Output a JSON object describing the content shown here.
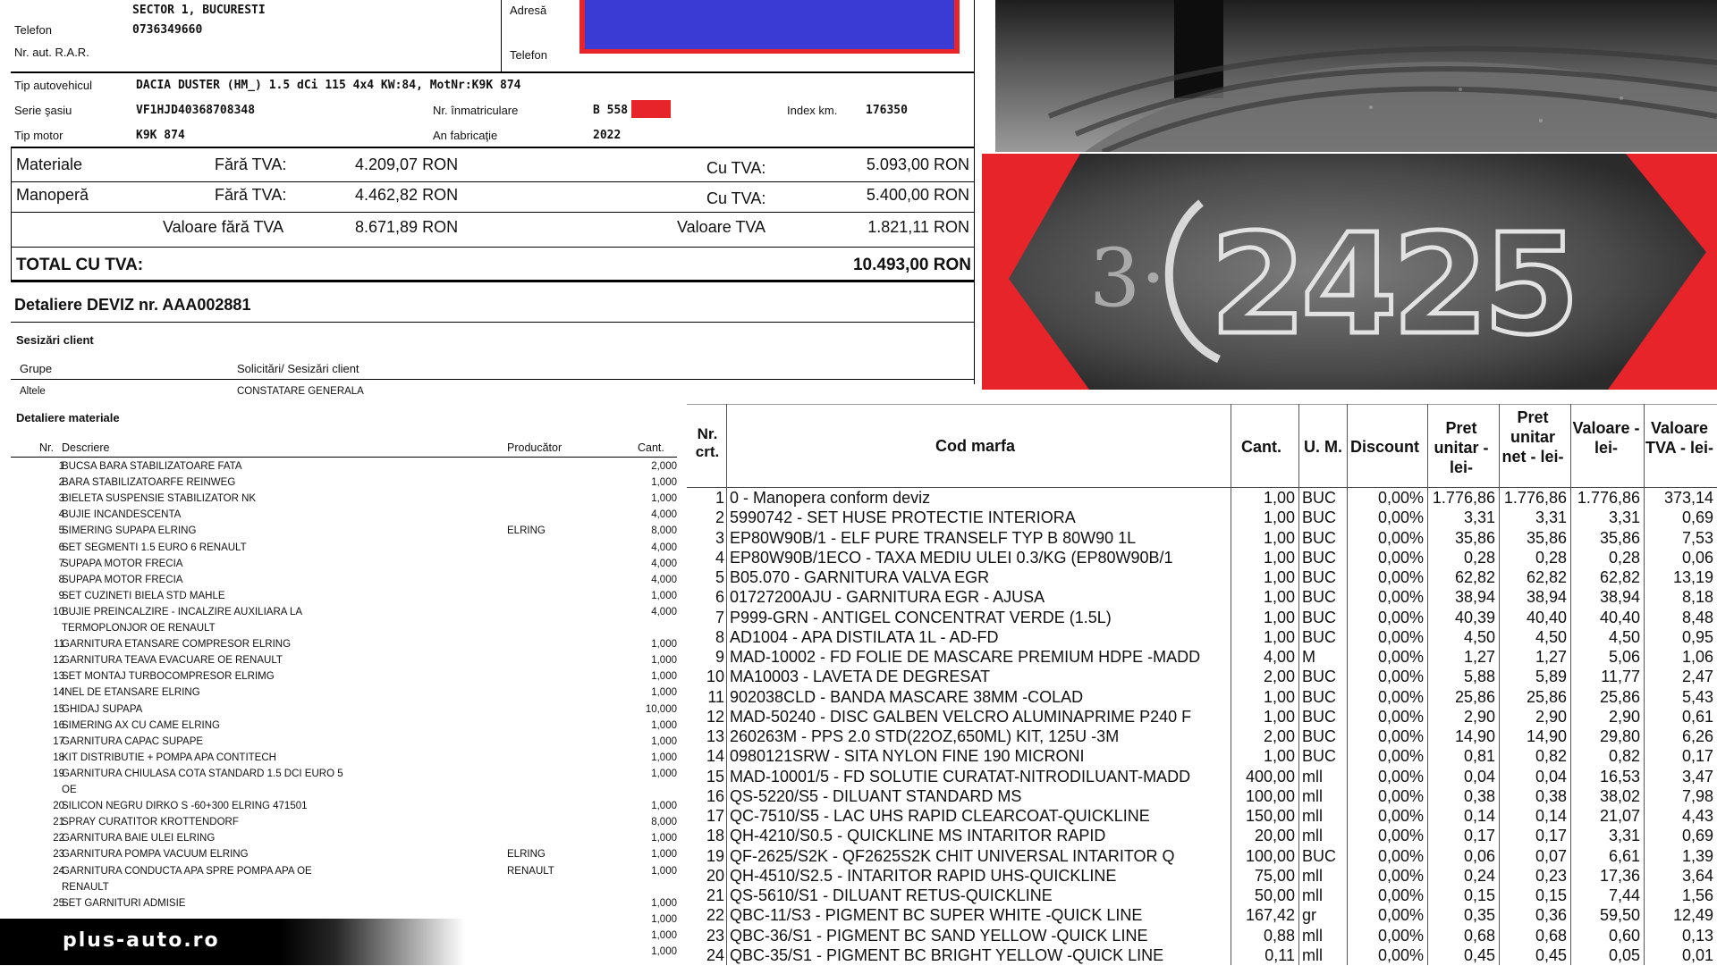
{
  "header": {
    "address_line": "SECTOR 1, BUCURESTI",
    "phone_label": "Telefon",
    "phone_value": "0736349660",
    "rar_label": "Nr. aut. R.A.R.",
    "client_address_label": "Adresă",
    "client_phone_label": "Telefon"
  },
  "vehicle": {
    "type_label": "Tip autovehicul",
    "type_value": "DACIA DUSTER (HM_) 1.5 dCi 115 4x4 KW:84, MotNr:K9K 874",
    "vin_label": "Serie şasiu",
    "vin_value": "VF1HJD40368708348",
    "plate_label": "Nr. înmatriculare",
    "plate_value": "B 558",
    "km_label": "Index km.",
    "km_value": "176350",
    "engine_label": "Tip motor",
    "engine_value": "K9K 874",
    "year_label": "An fabricaţie",
    "year_value": "2022"
  },
  "summary": {
    "materials_label": "Materiale",
    "labour_label": "Manoperă",
    "no_vat_label": "Fără TVA:",
    "with_vat_label": "Cu TVA:",
    "materials_no_vat": "4.209,07 RON",
    "materials_with_vat": "5.093,00 RON",
    "labour_no_vat": "4.462,82 RON",
    "labour_with_vat": "5.400,00 RON",
    "value_no_vat_label": "Valoare fără TVA",
    "value_no_vat": "8.671,89 RON",
    "vat_value_label": "Valoare TVA",
    "vat_value": "1.821,11 RON",
    "total_label": "TOTAL CU TVA:",
    "total_value": "10.493,00 RON"
  },
  "deviz_title": "Detaliere DEVIZ nr. AAA002881",
  "complaints": {
    "title": "Sesizări client",
    "col_group": "Grupe",
    "col_request": "Solicitări/ Sesizări client",
    "row_group": "Altele",
    "row_request": "CONSTATARE GENERALA"
  },
  "materials": {
    "title": "Detaliere materiale",
    "col_nr": "Nr.",
    "col_desc": "Descriere",
    "col_producer": "Producător",
    "col_qty": "Cant.",
    "rows": [
      {
        "nr": "1",
        "desc": "BUCSA BARA STABILIZATOARE FATA",
        "prod": "",
        "qty": "2,000"
      },
      {
        "nr": "2",
        "desc": "BARA STABILIZATOARFE REINWEG",
        "prod": "",
        "qty": "1,000"
      },
      {
        "nr": "3",
        "desc": "BIELETA SUSPENSIE STABILIZATOR NK",
        "prod": "",
        "qty": "1,000"
      },
      {
        "nr": "4",
        "desc": "BUJIE INCANDESCENTA",
        "prod": "",
        "qty": "4,000"
      },
      {
        "nr": "5",
        "desc": "SIMERING SUPAPA ELRING",
        "prod": "ELRING",
        "qty": "8,000"
      },
      {
        "nr": "6",
        "desc": "SET SEGMENTI 1.5 EURO 6 RENAULT",
        "prod": "",
        "qty": "4,000"
      },
      {
        "nr": "7",
        "desc": "SUPAPA MOTOR FRECIA",
        "prod": "",
        "qty": "4,000"
      },
      {
        "nr": "8",
        "desc": "SUPAPA MOTOR FRECIA",
        "prod": "",
        "qty": "4,000"
      },
      {
        "nr": "9",
        "desc": "SET CUZINETI BIELA STD MAHLE",
        "prod": "",
        "qty": "1,000"
      },
      {
        "nr": "10",
        "desc": "BUJIE PREINCALZIRE - INCALZIRE AUXILIARA LA",
        "prod": "",
        "qty": "4,000"
      },
      {
        "nr": "",
        "desc": "TERMOPLONJOR OE RENAULT",
        "prod": "",
        "qty": ""
      },
      {
        "nr": "11",
        "desc": "GARNITURA ETANSARE COMPRESOR ELRING",
        "prod": "",
        "qty": "1,000"
      },
      {
        "nr": "12",
        "desc": "GARNITURA TEAVA EVACUARE OE RENAULT",
        "prod": "",
        "qty": "1,000"
      },
      {
        "nr": "13",
        "desc": "SET MONTAJ TURBOCOMPRESOR ELRIMG",
        "prod": "",
        "qty": "1,000"
      },
      {
        "nr": "14",
        "desc": "INEL DE ETANSARE ELRING",
        "prod": "",
        "qty": "1,000"
      },
      {
        "nr": "15",
        "desc": "GHIDAJ SUPAPA",
        "prod": "",
        "qty": "10,000"
      },
      {
        "nr": "16",
        "desc": "SIMERING AX CU CAME ELRING",
        "prod": "",
        "qty": "1,000"
      },
      {
        "nr": "17",
        "desc": "GARNITURA CAPAC SUPAPE",
        "prod": "",
        "qty": "1,000"
      },
      {
        "nr": "18",
        "desc": "KIT DISTRIBUTIE + POMPA APA CONTITECH",
        "prod": "",
        "qty": "1,000"
      },
      {
        "nr": "19",
        "desc": "GARNITURA CHIULASA COTA STANDARD 1.5 DCI EURO 5",
        "prod": "",
        "qty": "1,000"
      },
      {
        "nr": "",
        "desc": "OE",
        "prod": "",
        "qty": ""
      },
      {
        "nr": "20",
        "desc": "SILICON NEGRU DIRKO S -60+300 ELRING 471501",
        "prod": "",
        "qty": "1,000"
      },
      {
        "nr": "21",
        "desc": "SPRAY CURATITOR KROTTENDORF",
        "prod": "",
        "qty": "8,000"
      },
      {
        "nr": "22",
        "desc": "GARNITURA BAIE ULEI ELRING",
        "prod": "",
        "qty": "1,000"
      },
      {
        "nr": "23",
        "desc": "GARNITURA POMPA VACUUM ELRING",
        "prod": "ELRING",
        "qty": "1,000"
      },
      {
        "nr": "24",
        "desc": "GARNITURA CONDUCTA APA SPRE POMPA APA OE",
        "prod": "RENAULT",
        "qty": "1,000"
      },
      {
        "nr": "",
        "desc": "RENAULT",
        "prod": "",
        "qty": ""
      },
      {
        "nr": "25",
        "desc": "SET GARNITURI ADMISIE",
        "prod": "",
        "qty": "1,000"
      }
    ],
    "extra_qty": [
      "1,000",
      "1,000",
      "1,000"
    ]
  },
  "invoice": {
    "col_nr": "Nr. crt.",
    "col_code": "Cod marfa",
    "col_qty": "Cant.",
    "col_um": "U. M.",
    "col_discount": "Discount",
    "col_unit_price": "Pret unitar - lei-",
    "col_unit_net": "Pret unitar net - lei-",
    "col_value": "Valoare - lei-",
    "col_vat": "Valoare TVA - lei-",
    "rows": [
      {
        "nr": "1",
        "code": "0 - Manopera conform deviz",
        "qty": "1,00",
        "um": "BUC",
        "disc": "0,00%",
        "pu": "1.776,86",
        "pn": "1.776,86",
        "val": "1.776,86",
        "vat": "373,14"
      },
      {
        "nr": "2",
        "code": "5990742 - SET HUSE  PROTECTIE INTERIORA",
        "qty": "1,00",
        "um": "BUC",
        "disc": "0,00%",
        "pu": "3,31",
        "pn": "3,31",
        "val": "3,31",
        "vat": "0,69"
      },
      {
        "nr": "3",
        "code": "EP80W90B/1 - ELF PURE TRANSELF TYP B 80W90 1L",
        "qty": "1,00",
        "um": "BUC",
        "disc": "0,00%",
        "pu": "35,86",
        "pn": "35,86",
        "val": "35,86",
        "vat": "7,53"
      },
      {
        "nr": "4",
        "code": "EP80W90B/1ECO - TAXA MEDIU ULEI 0.3/KG (EP80W90B/1",
        "qty": "1,00",
        "um": "BUC",
        "disc": "0,00%",
        "pu": "0,28",
        "pn": "0,28",
        "val": "0,28",
        "vat": "0,06"
      },
      {
        "nr": "5",
        "code": "B05.070 - GARNITURA VALVA EGR",
        "qty": "1,00",
        "um": "BUC",
        "disc": "0,00%",
        "pu": "62,82",
        "pn": "62,82",
        "val": "62,82",
        "vat": "13,19"
      },
      {
        "nr": "6",
        "code": "01727200AJU - GARNITURA EGR - AJUSA",
        "qty": "1,00",
        "um": "BUC",
        "disc": "0,00%",
        "pu": "38,94",
        "pn": "38,94",
        "val": "38,94",
        "vat": "8,18"
      },
      {
        "nr": "7",
        "code": "P999-GRN - ANTIGEL CONCENTRAT VERDE (1.5L)",
        "qty": "1,00",
        "um": "BUC",
        "disc": "0,00%",
        "pu": "40,39",
        "pn": "40,40",
        "val": "40,40",
        "vat": "8,48"
      },
      {
        "nr": "8",
        "code": "AD1004 - APA DISTILATA 1L - AD-FD",
        "qty": "1,00",
        "um": "BUC",
        "disc": "0,00%",
        "pu": "4,50",
        "pn": "4,50",
        "val": "4,50",
        "vat": "0,95"
      },
      {
        "nr": "9",
        "code": "MAD-10002 - FD FOLIE DE MASCARE PREMIUM HDPE -MADD",
        "qty": "4,00",
        "um": "M",
        "disc": "0,00%",
        "pu": "1,27",
        "pn": "1,27",
        "val": "5,06",
        "vat": "1,06"
      },
      {
        "nr": "10",
        "code": "MA10003 - LAVETA DE DEGRESAT",
        "qty": "2,00",
        "um": "BUC",
        "disc": "0,00%",
        "pu": "5,88",
        "pn": "5,89",
        "val": "11,77",
        "vat": "2,47"
      },
      {
        "nr": "11",
        "code": "902038CLD - BANDA MASCARE 38MM -COLAD",
        "qty": "1,00",
        "um": "BUC",
        "disc": "0,00%",
        "pu": "25,86",
        "pn": "25,86",
        "val": "25,86",
        "vat": "5,43"
      },
      {
        "nr": "12",
        "code": "MAD-50240 - DISC GALBEN VELCRO ALUMINAPRIME P240 F",
        "qty": "1,00",
        "um": "BUC",
        "disc": "0,00%",
        "pu": "2,90",
        "pn": "2,90",
        "val": "2,90",
        "vat": "0,61"
      },
      {
        "nr": "13",
        "code": "260263M - PPS 2.0 STD(22OZ,650ML) KIT, 125U -3M",
        "qty": "2,00",
        "um": "BUC",
        "disc": "0,00%",
        "pu": "14,90",
        "pn": "14,90",
        "val": "29,80",
        "vat": "6,26"
      },
      {
        "nr": "14",
        "code": "0980121SRW - SITA NYLON FINE 190 MICRONI",
        "qty": "1,00",
        "um": "BUC",
        "disc": "0,00%",
        "pu": "0,81",
        "pn": "0,82",
        "val": "0,82",
        "vat": "0,17"
      },
      {
        "nr": "15",
        "code": "MAD-10001/5 - FD SOLUTIE CURATAT-NITRODILUANT-MADD",
        "qty": "400,00",
        "um": "mll",
        "disc": "0,00%",
        "pu": "0,04",
        "pn": "0,04",
        "val": "16,53",
        "vat": "3,47"
      },
      {
        "nr": "16",
        "code": "QS-5220/S5 - DILUANT STANDARD MS",
        "qty": "100,00",
        "um": "mll",
        "disc": "0,00%",
        "pu": "0,38",
        "pn": "0,38",
        "val": "38,02",
        "vat": "7,98"
      },
      {
        "nr": "17",
        "code": "QC-7510/S5 - LAC UHS RAPID CLEARCOAT-QUICKLINE",
        "qty": "150,00",
        "um": "mll",
        "disc": "0,00%",
        "pu": "0,14",
        "pn": "0,14",
        "val": "21,07",
        "vat": "4,43"
      },
      {
        "nr": "18",
        "code": "QH-4210/S0.5 - QUICKLINE MS INTARITOR RAPID",
        "qty": "20,00",
        "um": "mll",
        "disc": "0,00%",
        "pu": "0,17",
        "pn": "0,17",
        "val": "3,31",
        "vat": "0,69"
      },
      {
        "nr": "19",
        "code": "QF-2625/S2K - QF2625S2K CHIT UNIVERSAL INTARITOR Q",
        "qty": "100,00",
        "um": "BUC",
        "disc": "0,00%",
        "pu": "0,06",
        "pn": "0,07",
        "val": "6,61",
        "vat": "1,39"
      },
      {
        "nr": "20",
        "code": "QH-4510/S2.5 - INTARITOR RAPID UHS-QUICKLINE",
        "qty": "75,00",
        "um": "mll",
        "disc": "0,00%",
        "pu": "0,24",
        "pn": "0,23",
        "val": "17,36",
        "vat": "3,64"
      },
      {
        "nr": "21",
        "code": "QS-5610/S1 - DILUANT RETUS-QUICKLINE",
        "qty": "50,00",
        "um": "mll",
        "disc": "0,00%",
        "pu": "0,15",
        "pn": "0,15",
        "val": "7,44",
        "vat": "1,56"
      },
      {
        "nr": "22",
        "code": "QBC-11/S3 - PIGMENT BC SUPER WHITE -QUICK LINE",
        "qty": "167,42",
        "um": "gr",
        "disc": "0,00%",
        "pu": "0,35",
        "pn": "0,36",
        "val": "59,50",
        "vat": "12,49"
      },
      {
        "nr": "23",
        "code": "QBC-36/S1 - PIGMENT BC SAND YELLOW -QUICK LINE",
        "qty": "0,88",
        "um": "mll",
        "disc": "0,00%",
        "pu": "0,68",
        "pn": "0,68",
        "val": "0,60",
        "vat": "0,13"
      },
      {
        "nr": "24",
        "code": "QBC-35/S1 - PIGMENT BC BRIGHT YELLOW -QUICK LINE",
        "qty": "0,11",
        "um": "mll",
        "disc": "0,00%",
        "pu": "0,45",
        "pn": "0,45",
        "val": "0,05",
        "vat": "0,01"
      }
    ]
  },
  "tire_code": "2425",
  "tire_prefix": "3·",
  "brand": "plus-auto.ro",
  "colors": {
    "accent_red": "#e8242b",
    "redact_blue": "#3a3ad4"
  },
  "icons": [
    "tire-photo",
    "dot-code-photo"
  ]
}
